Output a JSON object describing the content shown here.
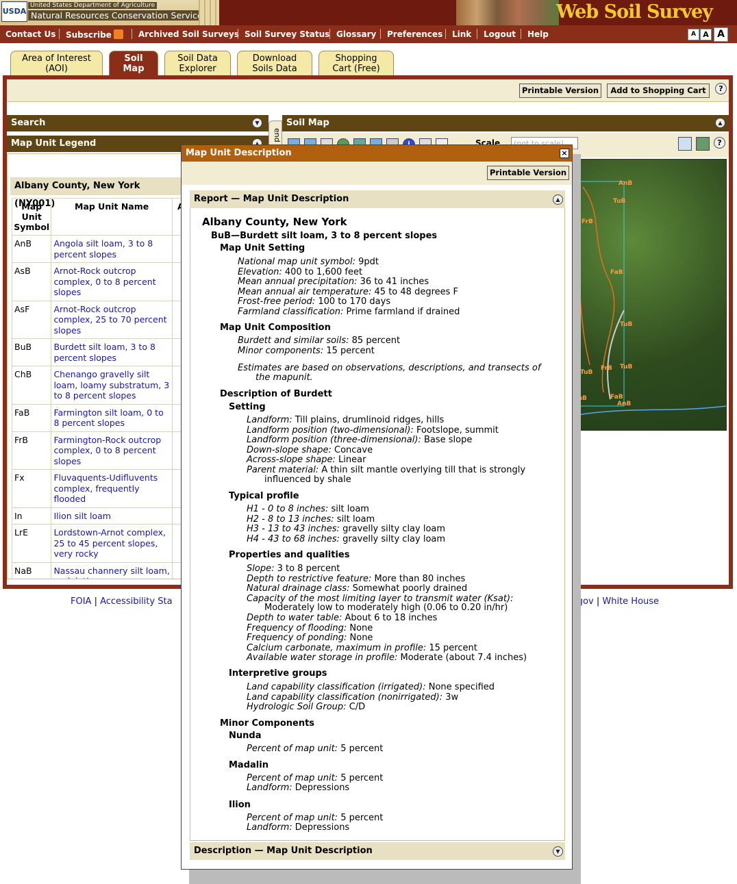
{
  "header": {
    "logo_text": "USDA",
    "department": "United States Department of Agriculture",
    "agency": "Natural Resources Conservation Service",
    "app_title": "Web Soil Survey"
  },
  "nav": [
    "Contact Us",
    "Subscribe",
    "Archived Soil Surveys",
    "Soil Survey Status",
    "Glossary",
    "Preferences",
    "Link",
    "Logout",
    "Help"
  ],
  "font_sizes": [
    "A",
    "A",
    "A"
  ],
  "tabs": [
    {
      "line1": "Area of Interest",
      "line2": "(AOI)"
    },
    {
      "line1": "Soil",
      "line2": "Map"
    },
    {
      "line1": "Soil Data",
      "line2": "Explorer"
    },
    {
      "line1": "Download",
      "line2": "Soils Data"
    },
    {
      "line1": "Shopping",
      "line2": "Cart (Free)"
    }
  ],
  "toolbar": {
    "printable": "Printable Version",
    "add_cart": "Add to Shopping Cart",
    "help": "?"
  },
  "panels": {
    "search": "Search",
    "legend": "Map Unit Legend",
    "soil_map": "Soil Map",
    "legend_side_tab": "end"
  },
  "map_controls": {
    "scale_label": "Scale",
    "scale_value": "(not to scale)"
  },
  "legend": {
    "county": "Albany County, New York (NY001)",
    "headers": [
      "Map Unit Symbol",
      "Map Unit Name",
      "A"
    ],
    "rows": [
      {
        "sym": "AnB",
        "name": "Angola silt loam, 3 to 8 percent slopes"
      },
      {
        "sym": "AsB",
        "name": "Arnot-Rock outcrop complex, 0 to 8 percent slopes"
      },
      {
        "sym": "AsF",
        "name": "Arnot-Rock outcrop complex, 25 to 70 percent slopes"
      },
      {
        "sym": "BuB",
        "name": "Burdett silt loam, 3 to 8 percent slopes"
      },
      {
        "sym": "ChB",
        "name": "Chenango gravelly silt loam, loamy substratum, 3 to 8 percent slopes"
      },
      {
        "sym": "FaB",
        "name": "Farmington silt loam, 0 to 8 percent slopes"
      },
      {
        "sym": "FrB",
        "name": "Farmington-Rock outcrop complex, 0 to 8 percent slopes"
      },
      {
        "sym": "Fx",
        "name": "Fluvaquents-Udifluvents complex, frequently flooded"
      },
      {
        "sym": "In",
        "name": "Ilion silt loam"
      },
      {
        "sym": "LrE",
        "name": "Lordstown-Arnot complex, 25 to 45 percent slopes, very rocky"
      },
      {
        "sym": "NaB",
        "name": "Nassau channery silt loam, undulating"
      }
    ]
  },
  "map_labels": [
    "AnB",
    "TuB",
    "FrB",
    "FaB",
    "TuB",
    "TuB",
    "FrB",
    "TuB",
    "ChB",
    "FaB",
    "AnB"
  ],
  "modal": {
    "title": "Map Unit Description",
    "close": "×",
    "printable": "Printable Version",
    "report_bar": "Report — Map Unit Description",
    "description_bar": "Description — Map Unit Description",
    "county": "Albany County, New York",
    "unit": "BuB—Burdett silt loam, 3 to 8 percent slopes",
    "setting_title": "Map Unit Setting",
    "setting": [
      {
        "k": "National map unit symbol:",
        "v": "9pdt"
      },
      {
        "k": "Elevation:",
        "v": "400 to 1,600 feet"
      },
      {
        "k": "Mean annual precipitation:",
        "v": "36 to 41 inches"
      },
      {
        "k": "Mean annual air temperature:",
        "v": "45 to 48 degrees F"
      },
      {
        "k": "Frost-free period:",
        "v": "100 to 170 days"
      },
      {
        "k": "Farmland classification:",
        "v": "Prime farmland if drained"
      }
    ],
    "composition_title": "Map Unit Composition",
    "composition": [
      {
        "k": "Burdett and similar soils:",
        "v": "85 percent"
      },
      {
        "k": "Minor components:",
        "v": "15 percent"
      }
    ],
    "estimates_1": "Estimates are based on observations, descriptions, and transects of",
    "estimates_2": "the mapunit.",
    "desc_title": "Description of Burdett",
    "setting2_title": "Setting",
    "setting2": [
      {
        "k": "Landform:",
        "v": "Till plains, drumlinoid ridges, hills"
      },
      {
        "k": "Landform position (two-dimensional):",
        "v": "Footslope, summit"
      },
      {
        "k": "Landform position (three-dimensional):",
        "v": "Base slope"
      },
      {
        "k": "Down-slope shape:",
        "v": "Concave"
      },
      {
        "k": "Across-slope shape:",
        "v": "Linear"
      },
      {
        "k": "Parent material:",
        "v": "A thin silt mantle overlying till that is strongly"
      }
    ],
    "parent_cont": "influenced by shale",
    "profile_title": "Typical profile",
    "profile": [
      {
        "k": "H1 - 0 to 8 inches:",
        "v": "silt loam"
      },
      {
        "k": "H2 - 8 to 13 inches:",
        "v": "silt loam"
      },
      {
        "k": "H3 - 13 to 43 inches:",
        "v": "gravelly silty clay loam"
      },
      {
        "k": "H4 - 43 to 68 inches:",
        "v": "gravelly silty clay loam"
      }
    ],
    "props_title": "Properties and qualities",
    "props": [
      {
        "k": "Slope:",
        "v": "3 to 8 percent"
      },
      {
        "k": "Depth to restrictive feature:",
        "v": "More than 80 inches"
      },
      {
        "k": "Natural drainage class:",
        "v": "Somewhat poorly drained"
      },
      {
        "k": "Capacity of the most limiting layer to transmit water (Ksat):",
        "v": ""
      }
    ],
    "ksat_cont": "Moderately low to moderately high (0.06 to 0.20 in/hr)",
    "props2": [
      {
        "k": "Depth to water table:",
        "v": "About 6 to 18 inches"
      },
      {
        "k": "Frequency of flooding:",
        "v": "None"
      },
      {
        "k": "Frequency of ponding:",
        "v": "None"
      },
      {
        "k": "Calcium carbonate, maximum in profile:",
        "v": "15 percent"
      },
      {
        "k": "Available water storage in profile:",
        "v": "Moderate (about 7.4 inches)"
      }
    ],
    "interp_title": "Interpretive groups",
    "interp": [
      {
        "k": "Land capability classification (irrigated):",
        "v": "None specified"
      },
      {
        "k": "Land capability classification (nonirrigated):",
        "v": "3w"
      },
      {
        "k": "Hydrologic Soil Group:",
        "v": "C/D"
      }
    ],
    "minor_title": "Minor Components",
    "minor": [
      {
        "name": "Nunda",
        "pct_k": "Percent of map unit:",
        "pct_v": "5 percent",
        "lf": ""
      },
      {
        "name": "Madalin",
        "pct_k": "Percent of map unit:",
        "pct_v": "5 percent",
        "lf_k": "Landform:",
        "lf": "Depressions"
      },
      {
        "name": "Ilion",
        "pct_k": "Percent of map unit:",
        "pct_v": "5 percent",
        "lf_k": "Landform:",
        "lf": "Depressions"
      }
    ]
  },
  "footer": {
    "left1": "FOIA",
    "left2": "Accessibility Sta",
    "right1": "A.gov",
    "right2": "White House"
  }
}
